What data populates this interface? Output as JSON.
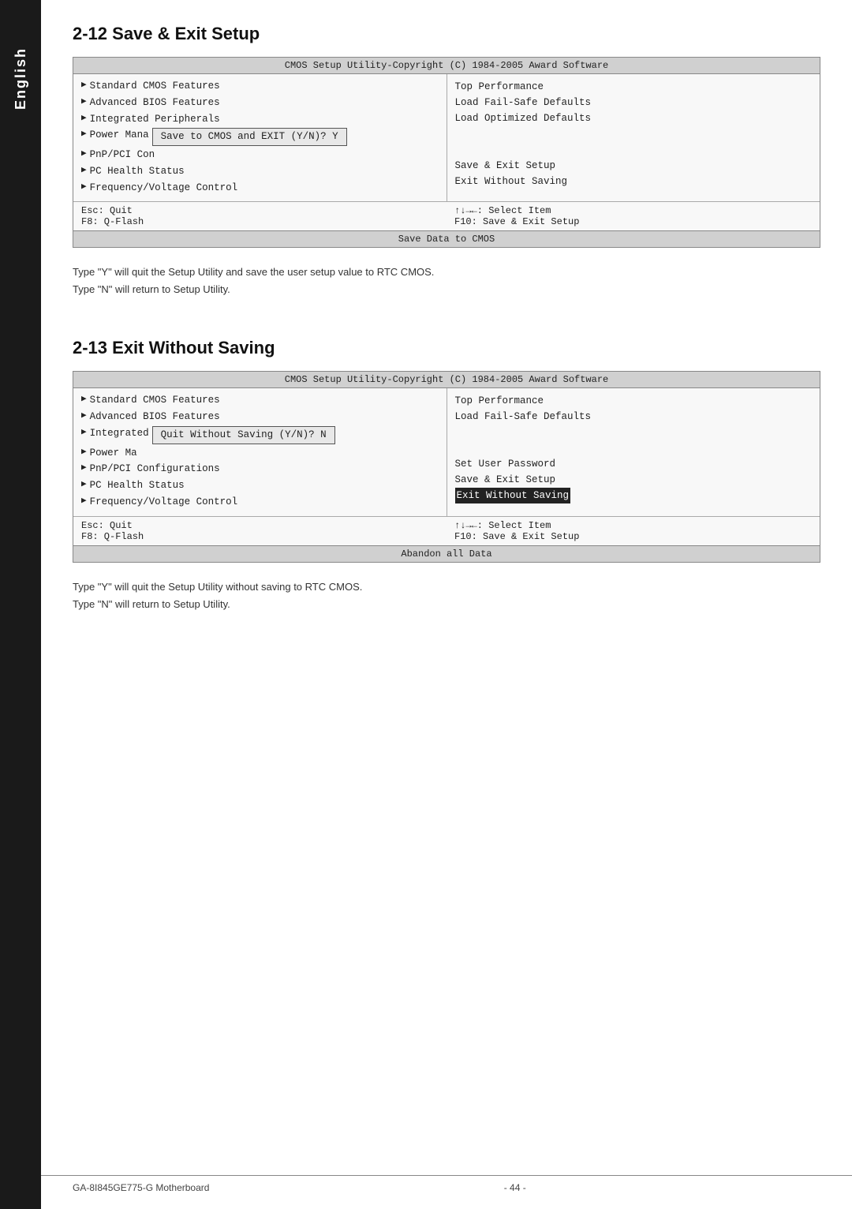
{
  "sidebar": {
    "label": "English"
  },
  "section1": {
    "heading": "2-12  Save & Exit Setup",
    "bios": {
      "title": "CMOS Setup Utility-Copyright (C) 1984-2005 Award Software",
      "left_items": [
        "Standard CMOS Features",
        "Advanced BIOS Features",
        "Integrated Peripherals",
        "Power Mana",
        "PnP/PCI Con",
        "PC Health Status",
        "Frequency/Voltage Control"
      ],
      "right_items": [
        "Top Performance",
        "Load Fail-Safe Defaults",
        "Load Optimized Defaults",
        "",
        "",
        "Save & Exit Setup",
        "Exit Without Saving"
      ],
      "dialog_text": "Save to CMOS and EXIT (Y/N)? Y",
      "footer_left1": "Esc:  Quit",
      "footer_left2": "F8:  Q-Flash",
      "footer_right1": "↑↓→←:  Select Item",
      "footer_right2": "F10:  Save & Exit Setup",
      "bottom_bar": "Save Data to CMOS"
    },
    "desc1": "Type \"Y\" will quit the Setup Utility and save the user setup value to RTC CMOS.",
    "desc2": "Type \"N\" will return to Setup Utility."
  },
  "section2": {
    "heading": "2-13  Exit Without Saving",
    "bios": {
      "title": "CMOS Setup Utility-Copyright (C) 1984-2005 Award Software",
      "left_items": [
        "Standard CMOS Features",
        "Advanced BIOS Features",
        "Integrated",
        "Power Ma",
        "PnP/PCI Configurations",
        "PC Health Status",
        "Frequency/Voltage Control"
      ],
      "right_items": [
        "Top Performance",
        "Load Fail-Safe Defaults",
        "",
        "",
        "Set User Password",
        "Save & Exit Setup",
        "Exit Without Saving"
      ],
      "dialog_text": "Quit Without Saving (Y/N)? N",
      "footer_left1": "Esc:  Quit",
      "footer_left2": "F8:  Q-Flash",
      "footer_right1": "↑↓→←:  Select Item",
      "footer_right2": "F10:  Save & Exit Setup",
      "bottom_bar": "Abandon all Data"
    },
    "desc1": "Type \"Y\" will quit the Setup Utility without saving to RTC CMOS.",
    "desc2": "Type \"N\" will return to Setup Utility."
  },
  "footer": {
    "left": "GA-8I845GE775-G Motherboard",
    "center": "- 44 -",
    "right": ""
  }
}
